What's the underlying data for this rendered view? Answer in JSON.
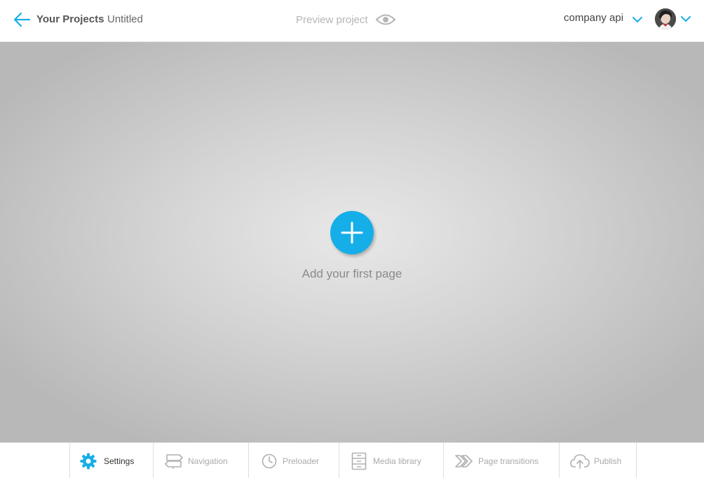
{
  "header": {
    "back_icon": "arrow-left-icon",
    "projects_label": "Your Projects",
    "project_title": "Untitled",
    "preview_label": "Preview project",
    "preview_icon": "eye-icon",
    "company_label": "company api",
    "chevron_icon": "chevron-down-icon"
  },
  "canvas": {
    "add_icon": "plus-icon",
    "add_label": "Add your first page"
  },
  "toolbar": {
    "items": [
      {
        "label": "Settings",
        "icon": "gear-icon",
        "active": true
      },
      {
        "label": "Navigation",
        "icon": "signpost-icon",
        "active": false
      },
      {
        "label": "Preloader",
        "icon": "clock-icon",
        "active": false
      },
      {
        "label": "Media library",
        "icon": "cabinet-icon",
        "active": false
      },
      {
        "label": "Page transitions",
        "icon": "chevrons-right-icon",
        "active": false
      },
      {
        "label": "Publish",
        "icon": "cloud-upload-icon",
        "active": false
      }
    ]
  },
  "colors": {
    "accent": "#16aee8",
    "muted_text": "#aaaaaa",
    "canvas_center": "#e8e8e8",
    "canvas_edge": "#b8b8b8"
  }
}
